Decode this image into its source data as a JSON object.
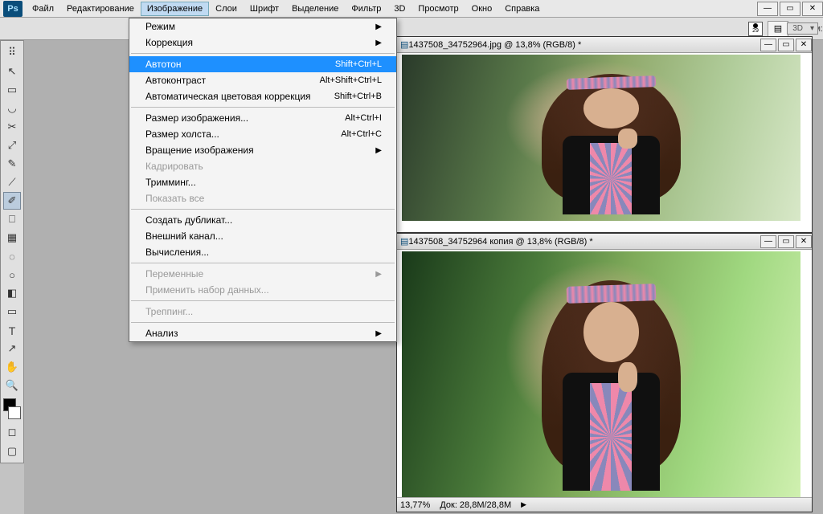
{
  "menubar": {
    "items": [
      "Файл",
      "Редактирование",
      "Изображение",
      "Слои",
      "Шрифт",
      "Выделение",
      "Фильтр",
      "3D",
      "Просмотр",
      "Окно",
      "Справка"
    ],
    "active_index": 2
  },
  "options_bar": {
    "mode_label": "Режим:",
    "brush_size": "29"
  },
  "panel_hint": "3D",
  "toolbox": {
    "tools": [
      "↖",
      "▭",
      "◡",
      "✂",
      "⤢",
      "✎",
      "⟋",
      "✐",
      "⎕",
      "▦",
      "◌",
      "○",
      "◧",
      "▭",
      "Ｔ",
      "↗",
      "✋",
      "🔍"
    ]
  },
  "dropdown": {
    "groups": [
      [
        {
          "label": "Режим",
          "sub": true
        },
        {
          "label": "Коррекция",
          "sub": true
        }
      ],
      [
        {
          "label": "Автотон",
          "shortcut": "Shift+Ctrl+L",
          "hl": true
        },
        {
          "label": "Автоконтраст",
          "shortcut": "Alt+Shift+Ctrl+L"
        },
        {
          "label": "Автоматическая цветовая коррекция",
          "shortcut": "Shift+Ctrl+B"
        }
      ],
      [
        {
          "label": "Размер изображения...",
          "shortcut": "Alt+Ctrl+I"
        },
        {
          "label": "Размер холста...",
          "shortcut": "Alt+Ctrl+C"
        },
        {
          "label": "Вращение изображения",
          "sub": true
        },
        {
          "label": "Кадрировать",
          "disabled": true
        },
        {
          "label": "Тримминг..."
        },
        {
          "label": "Показать все",
          "disabled": true
        }
      ],
      [
        {
          "label": "Создать дубликат..."
        },
        {
          "label": "Внешний канал..."
        },
        {
          "label": "Вычисления..."
        }
      ],
      [
        {
          "label": "Переменные",
          "sub": true,
          "disabled": true
        },
        {
          "label": "Применить набор данных...",
          "disabled": true
        }
      ],
      [
        {
          "label": "Треппинг...",
          "disabled": true
        }
      ],
      [
        {
          "label": "Анализ",
          "sub": true
        }
      ]
    ]
  },
  "documents": [
    {
      "title": "1437508_34752964.jpg @ 13,8% (RGB/8) *"
    },
    {
      "title": "1437508_34752964 копия @ 13,8% (RGB/8) *"
    }
  ],
  "status": {
    "zoom": "13,77%",
    "doc": "Док: 28,8М/28,8М",
    "arrow": "▶"
  },
  "app_ps": "Ps"
}
